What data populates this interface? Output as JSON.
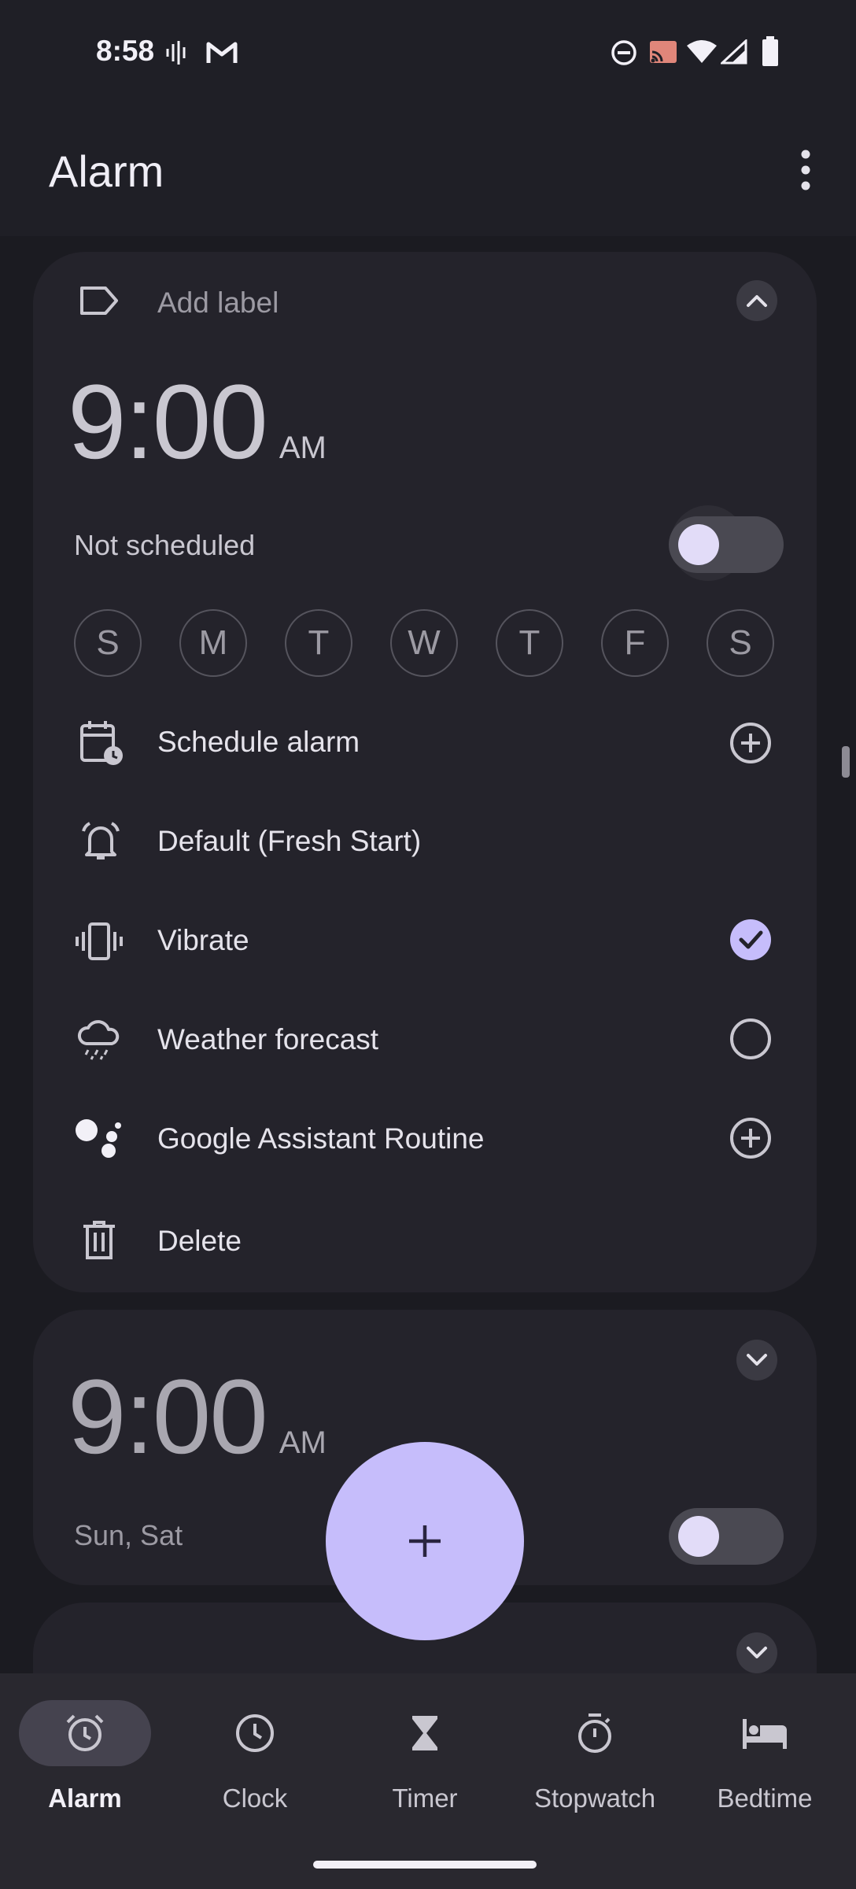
{
  "status_bar": {
    "time": "8:58"
  },
  "app_bar": {
    "title": "Alarm"
  },
  "alarm1": {
    "label_placeholder": "Add label",
    "time": "9:00",
    "ampm": "AM",
    "schedule_status": "Not scheduled",
    "enabled": false,
    "days": [
      "S",
      "M",
      "T",
      "W",
      "T",
      "F",
      "S"
    ],
    "options": {
      "schedule": "Schedule alarm",
      "sound": "Default (Fresh Start)",
      "vibrate": "Vibrate",
      "weather": "Weather forecast",
      "assistant": "Google Assistant Routine",
      "delete": "Delete"
    },
    "vibrate_checked": true,
    "weather_checked": false
  },
  "alarm2": {
    "time": "9:00",
    "ampm": "AM",
    "days_summary": "Sun, Sat",
    "enabled": false
  },
  "nav": {
    "items": [
      {
        "label": "Alarm",
        "icon": "alarm-icon",
        "selected": true
      },
      {
        "label": "Clock",
        "icon": "clock-icon",
        "selected": false
      },
      {
        "label": "Timer",
        "icon": "hourglass-icon",
        "selected": false
      },
      {
        "label": "Stopwatch",
        "icon": "stopwatch-icon",
        "selected": false
      },
      {
        "label": "Bedtime",
        "icon": "bed-icon",
        "selected": false
      }
    ]
  },
  "colors": {
    "accent": "#c6bdfb",
    "background": "#1b1b21",
    "card": "#24232b"
  }
}
